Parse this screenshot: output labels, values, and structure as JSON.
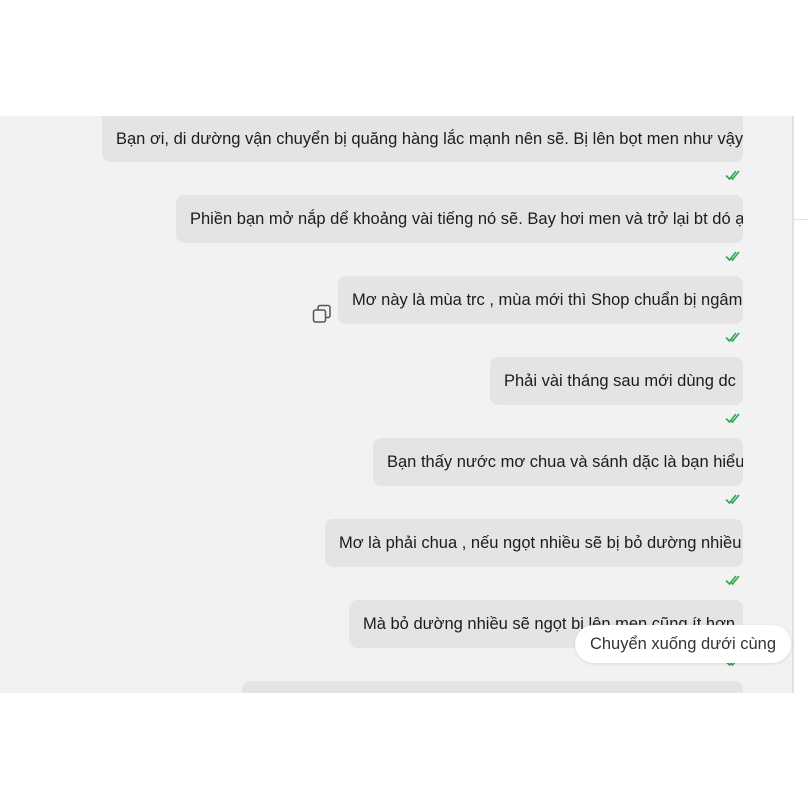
{
  "chat": {
    "messages": [
      {
        "text": "Bạn ơi, di dường vận chuyển bị quăng hàng lắc mạnh nên sẽ. Bị lên bọt men như vậy,"
      },
      {
        "text": "Phiền bạn mở nắp dể khoảng vài tiếng nó sẽ. Bay hơi men và trở lại bt dó ạ"
      },
      {
        "text": "Mơ này là mùa trc , mùa mới thì Shop chuẩn bị ngâm"
      },
      {
        "text": "Phải vài tháng sau mới dùng dc"
      },
      {
        "text": "Bạn thấy nước mơ chua và sánh dặc là bạn hiểu"
      },
      {
        "text": "Mơ là phải chua , nếu ngọt nhiều sẽ bị bỏ dường nhiều"
      },
      {
        "text": "Mà bỏ dường nhiều sẽ ngọt bị lên men cũng ít hơn"
      }
    ],
    "read_status_icon": "double-check-icon",
    "copy_icon": "copy-icon"
  },
  "scroll_button": {
    "label": "Chuyển xuống dưới cùng"
  },
  "colors": {
    "panel_bg": "#f2f2f2",
    "bubble_bg": "#e4e4e4",
    "read_tick": "#2fa84f"
  }
}
